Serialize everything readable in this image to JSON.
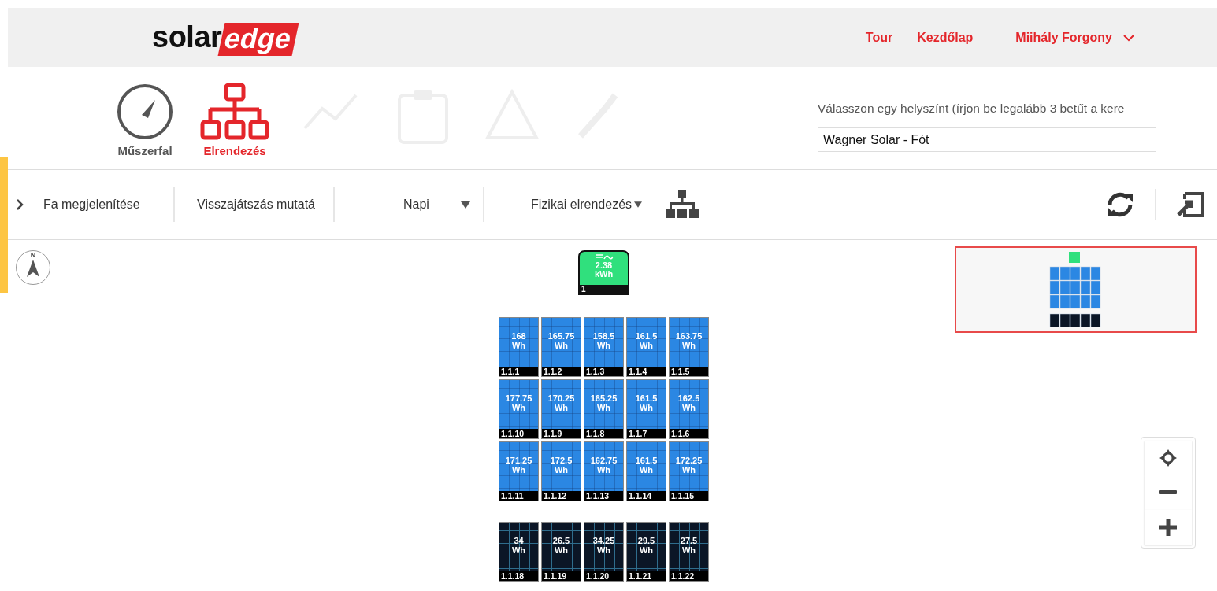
{
  "header": {
    "logo": {
      "dark_part": "solar",
      "red_part": "edge"
    },
    "links": [
      "Tour",
      "Kezdőlap"
    ],
    "user": "Miihály Forgony"
  },
  "nav": [
    {
      "kind": "gauge",
      "label": "Műszerfal",
      "selected": false
    },
    {
      "kind": "layout",
      "label": "Elrendezés",
      "selected": true
    }
  ],
  "site_selector": {
    "label": "Válasszon egy helyszínt (írjon be legalább 3 betűt a kere",
    "value": "Wagner Solar - Fót"
  },
  "toolbar": {
    "tree_toggle": "Fa megjelenítése",
    "playback": "Visszajátszás mutatá",
    "period": "Napi",
    "view": "Fizikai elrendezés"
  },
  "compass": "N",
  "inverter": {
    "energy": "2.38",
    "unit": "kWh",
    "id": "1"
  },
  "arrays": [
    {
      "rows": [
        {
          "panels": [
            {
              "energy": "168",
              "unit": "Wh",
              "id": "1.1.1",
              "kind": "normal"
            },
            {
              "energy": "165.75",
              "unit": "Wh",
              "id": "1.1.2",
              "kind": "normal"
            },
            {
              "energy": "158.5",
              "unit": "Wh",
              "id": "1.1.3",
              "kind": "normal"
            },
            {
              "energy": "161.5",
              "unit": "Wh",
              "id": "1.1.4",
              "kind": "normal"
            },
            {
              "energy": "163.75",
              "unit": "Wh",
              "id": "1.1.5",
              "kind": "normal"
            }
          ]
        },
        {
          "panels": [
            {
              "energy": "177.75",
              "unit": "Wh",
              "id": "1.1.10",
              "kind": "normal"
            },
            {
              "energy": "170.25",
              "unit": "Wh",
              "id": "1.1.9",
              "kind": "normal"
            },
            {
              "energy": "165.25",
              "unit": "Wh",
              "id": "1.1.8",
              "kind": "normal"
            },
            {
              "energy": "161.5",
              "unit": "Wh",
              "id": "1.1.7",
              "kind": "normal"
            },
            {
              "energy": "162.5",
              "unit": "Wh",
              "id": "1.1.6",
              "kind": "normal"
            }
          ]
        },
        {
          "panels": [
            {
              "energy": "171.25",
              "unit": "Wh",
              "id": "1.1.11",
              "kind": "normal"
            },
            {
              "energy": "172.5",
              "unit": "Wh",
              "id": "1.1.12",
              "kind": "normal"
            },
            {
              "energy": "162.75",
              "unit": "Wh",
              "id": "1.1.13",
              "kind": "normal"
            },
            {
              "energy": "161.5",
              "unit": "Wh",
              "id": "1.1.14",
              "kind": "normal"
            },
            {
              "energy": "172.25",
              "unit": "Wh",
              "id": "1.1.15",
              "kind": "normal"
            }
          ]
        }
      ]
    },
    {
      "rows": [
        {
          "panels": [
            {
              "energy": "34",
              "unit": "Wh",
              "id": "1.1.18",
              "kind": "low"
            },
            {
              "energy": "26.5",
              "unit": "Wh",
              "id": "1.1.19",
              "kind": "low"
            },
            {
              "energy": "34.25",
              "unit": "Wh",
              "id": "1.1.20",
              "kind": "low"
            },
            {
              "energy": "29.5",
              "unit": "Wh",
              "id": "1.1.21",
              "kind": "low"
            },
            {
              "energy": "27.5",
              "unit": "Wh",
              "id": "1.1.22",
              "kind": "low"
            }
          ]
        }
      ]
    }
  ]
}
